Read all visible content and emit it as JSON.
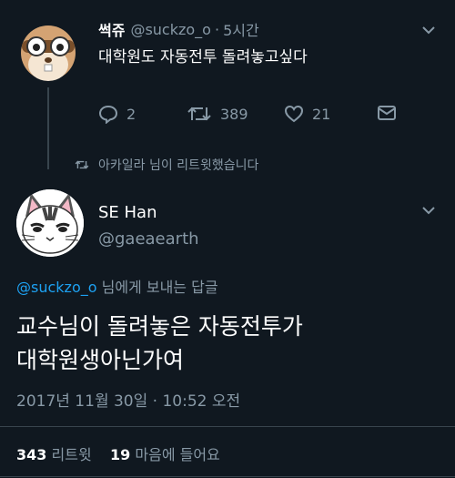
{
  "parent_tweet": {
    "display_name": "썩쥬",
    "handle": "@suckzo_o",
    "separator": "·",
    "time": "5시간",
    "text": "대학원도 자동전투 돌려놓고싶다",
    "reply_count": "2",
    "retweet_count": "389",
    "like_count": "21"
  },
  "retweet_notice": "아카일라 님이 리트윗했습니다",
  "main_tweet": {
    "display_name": "SE Han",
    "handle": "@gaeaearth",
    "reply_to_handle": "@suckzo_o",
    "reply_to_suffix": " 님에게 보내는 답글",
    "text_line1": "교수님이 돌려놓은 자동전투가",
    "text_line2": "대학원생아닌가여",
    "timestamp": "2017년 11월 30일 · 10:52 오전",
    "retweet_count": "343",
    "retweet_label": "리트윗",
    "like_count": "19",
    "like_label": "마음에 들어요"
  },
  "colors": {
    "background": "#101820",
    "muted": "#8899a6",
    "link": "#1da1f2",
    "divider": "#38444d"
  },
  "icons": [
    "reply-icon",
    "retweet-icon",
    "like-icon",
    "share-icon",
    "chevron-down-icon"
  ]
}
